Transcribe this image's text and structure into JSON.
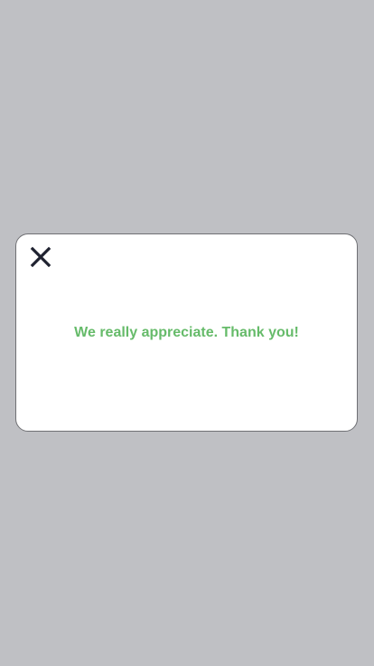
{
  "modal": {
    "message": "We really appreciate. Thank you!",
    "close_icon": "close-icon",
    "message_color": "#66bb6a",
    "close_color": "#1f2230"
  },
  "backdrop": {
    "color": "#bfc0c4"
  }
}
